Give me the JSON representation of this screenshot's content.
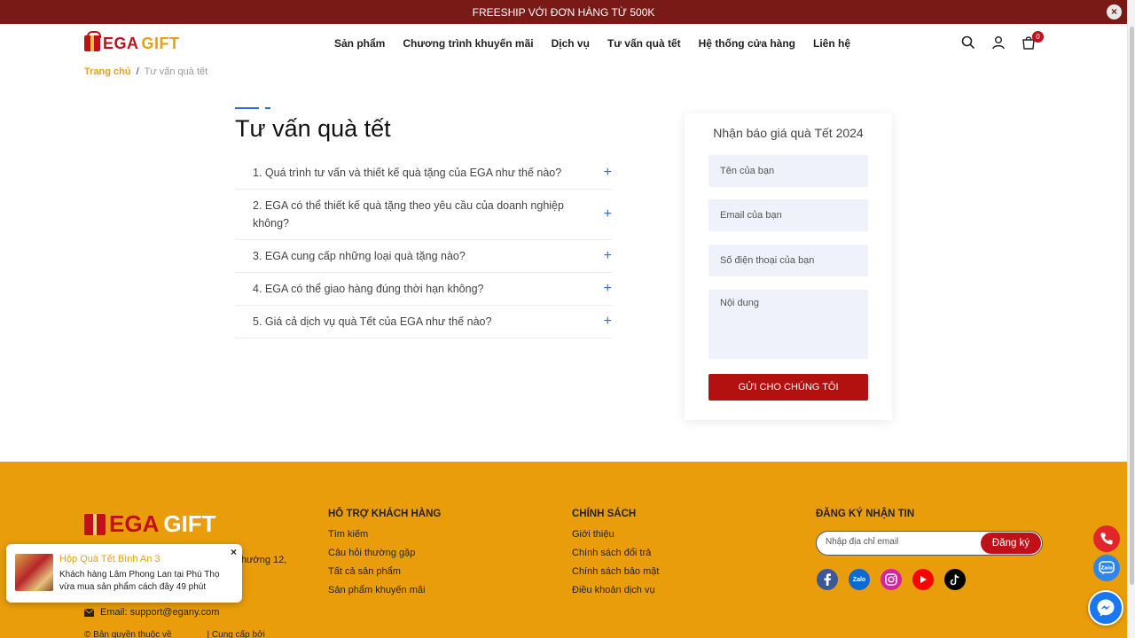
{
  "topbar": {
    "message": "FREESHIP VỚI ĐƠN HÀNG TỪ 500K",
    "close": "×"
  },
  "header": {
    "logo_a": "EGA",
    "logo_b": "GIFT",
    "nav": [
      "Sản phẩm",
      "Chương trình khuyến mãi",
      "Dịch vụ",
      "Tư vấn quà tết",
      "Hệ thống cửa hàng",
      "Liên hệ"
    ],
    "cart_count": "0",
    "icons": [
      "search-icon",
      "user-icon",
      "cart-icon"
    ]
  },
  "breadcrumb": {
    "home": "Trang chủ",
    "sep": "/",
    "current": "Tư vấn quà tết"
  },
  "main": {
    "title": "Tư vấn quà tết",
    "faq": [
      "1. Quá trình tư vấn và thiết kế quà tặng của EGA như thế nào?",
      "2. EGA có thể thiết kế quà tặng theo yêu cầu của doanh nghiệp không?",
      "3. EGA cung cấp những loại quà tặng nào?",
      "4. EGA có thể giao hàng đúng thời hạn không?",
      "5. Giá cả dịch vụ quà Tết của EGA như thế nào?"
    ],
    "plus": "+"
  },
  "form": {
    "title": "Nhận báo giá quà Tết 2024",
    "name_placeholder": "Tên của bạn",
    "email_placeholder": "Email của bạn",
    "phone_placeholder": "Số điện thoại của bạn",
    "content_placeholder": "Nội dung",
    "submit": "GỬI CHO CHÚNG TÔI"
  },
  "footer": {
    "logo_a": "EGA",
    "logo_b": "GIFT",
    "address_fragment": "hường 12,",
    "email": "Email: support@egany.com",
    "copyright_a": "© Bản quyền thuộc về",
    "copyright_b": "| Cung cấp bởi",
    "support": {
      "title": "HỖ TRỢ KHÁCH HÀNG",
      "links": [
        "Tìm kiếm",
        "Câu hỏi thường gặp",
        "Tất cả sản phẩm",
        "Sản phẩm khuyến mãi"
      ]
    },
    "policy": {
      "title": "CHÍNH SÁCH",
      "links": [
        "Giới thiệu",
        "Chính sách đổi trả",
        "Chính sách bảo mật",
        "Điều khoản dịch vụ"
      ]
    },
    "newsletter": {
      "title": "ĐĂNG KÝ NHẬN TIN",
      "placeholder": "Nhập địa chỉ email",
      "button": "Đăng ký"
    },
    "socials": [
      "facebook-icon",
      "zalo-icon",
      "instagram-icon",
      "youtube-icon",
      "tiktok-icon"
    ],
    "zalo_text": "Zalo",
    "social_colors": {
      "facebook": "#3b5998",
      "zalo": "#0b69d4",
      "instagram": "#d6249f",
      "youtube": "#ff0000",
      "tiktok": "#000000"
    }
  },
  "toast": {
    "title": "Hộp Quà Tết Bình An 3",
    "body": "Khách hàng Lâm Phong Lan tại Phú Thọ vừa mua sản phẩm cách đây 49 phút",
    "close": "×"
  },
  "floating": [
    "phone-icon",
    "zalo-icon",
    "messenger-icon"
  ],
  "colors": {
    "brand_red": "#b3110f",
    "accent_gold": "#e99d0b",
    "topbar": "#7a1a17",
    "link_blue": "#2b6fe0"
  }
}
